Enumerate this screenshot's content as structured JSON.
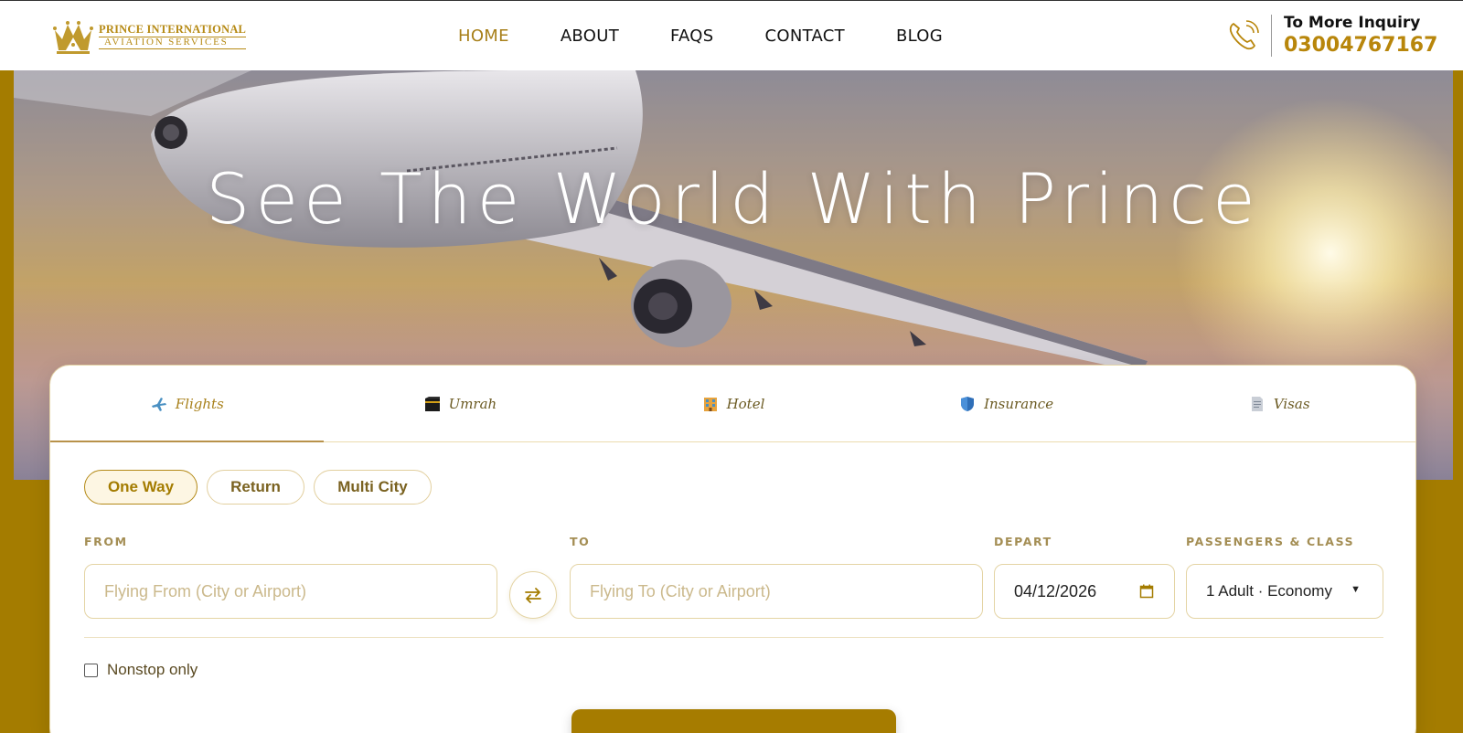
{
  "brand": {
    "line1": "PRINCE INTERNATIONAL",
    "line2": "AVIATION SERVICES"
  },
  "nav": [
    {
      "label": "HOME",
      "active": true
    },
    {
      "label": "ABOUT",
      "active": false
    },
    {
      "label": "FAQS",
      "active": false
    },
    {
      "label": "CONTACT",
      "active": false
    },
    {
      "label": "BLOG",
      "active": false
    }
  ],
  "inquiry": {
    "title": "To More Inquiry",
    "phone": "03004767167",
    "icon": "phone-icon"
  },
  "hero": {
    "title": "See The World With Prince"
  },
  "tabs": [
    {
      "label": "Flights",
      "icon": "airplane-icon",
      "active": true
    },
    {
      "label": "Umrah",
      "icon": "kaaba-icon",
      "active": false
    },
    {
      "label": "Hotel",
      "icon": "hotel-icon",
      "active": false
    },
    {
      "label": "Insurance",
      "icon": "shield-icon",
      "active": false
    },
    {
      "label": "Visas",
      "icon": "document-icon",
      "active": false
    }
  ],
  "trip_types": [
    {
      "label": "One Way",
      "active": true
    },
    {
      "label": "Return",
      "active": false
    },
    {
      "label": "Multi City",
      "active": false
    }
  ],
  "form": {
    "from_label": "FROM",
    "from_placeholder": "Flying From (City or Airport)",
    "to_label": "TO",
    "to_placeholder": "Flying To (City or Airport)",
    "depart_label": "DEPART",
    "depart_value": "04/12/2026",
    "passengers_label": "PASSENGERS & CLASS",
    "passengers_value": "1 Adult · Economy",
    "nonstop_label": "Nonstop only",
    "nonstop_checked": false
  },
  "colors": {
    "accent": "#a47c00",
    "gold_text": "#b8860b",
    "nav_active": "#a8801a"
  }
}
